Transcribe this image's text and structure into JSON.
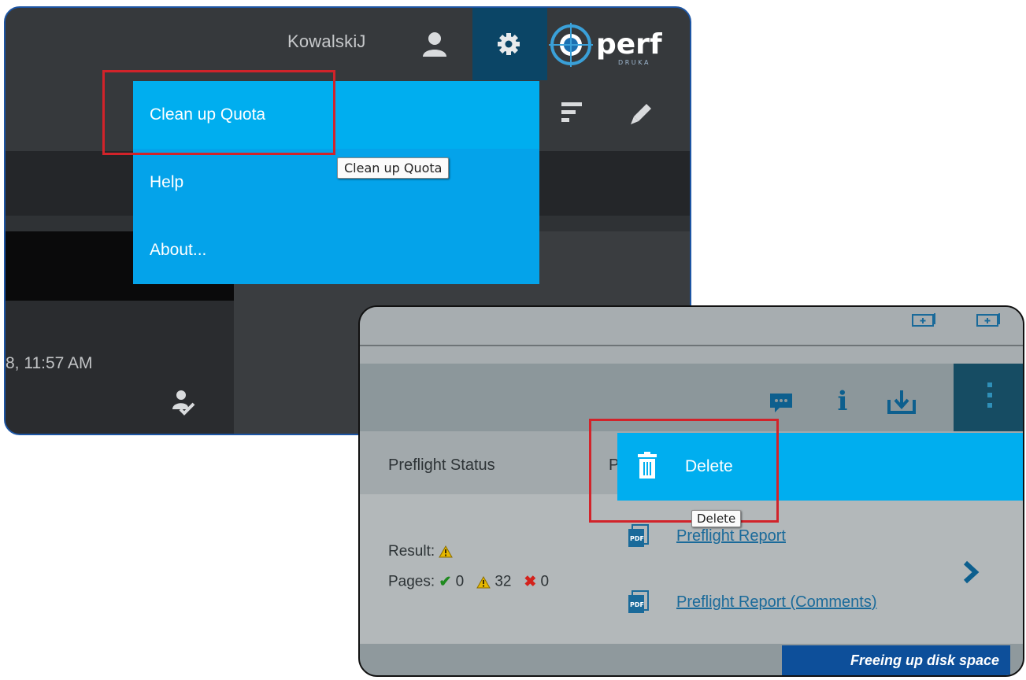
{
  "panel1": {
    "username": "KowalskiJ",
    "logo_text": "perf",
    "logo_subtext": "D R U K A",
    "menu": [
      {
        "label": "Clean up Quota"
      },
      {
        "label": "Help"
      },
      {
        "label": "About..."
      }
    ],
    "tooltip": "Clean up Quota",
    "date_fragment": "8, 11:57 AM",
    "icons": [
      "user-icon",
      "gear-icon",
      "sort-icon",
      "edit-icon",
      "approve-icon"
    ]
  },
  "panel2": {
    "columns": {
      "preflight_status": "Preflight Status",
      "second_partial": "P"
    },
    "menu": {
      "delete_label": "Delete"
    },
    "tooltip": "Delete",
    "result_label": "Result:",
    "pages_label": "Pages:",
    "pages_ok": "0",
    "pages_warn": "32",
    "pages_err": "0",
    "link1": "Preflight Report",
    "link2": "Preflight Report (Comments)",
    "icons": [
      "comment-icon",
      "info-icon",
      "download-icon",
      "kebab-menu-icon",
      "trash-icon",
      "pdf-icon",
      "chevron-right-icon"
    ]
  },
  "caption": "Freeing up disk space",
  "colors": {
    "menu_blue": "#00aeef",
    "highlight_red": "#d2232a",
    "caption_bg": "#0d4f9a",
    "panel_border": "#1d55a3"
  }
}
